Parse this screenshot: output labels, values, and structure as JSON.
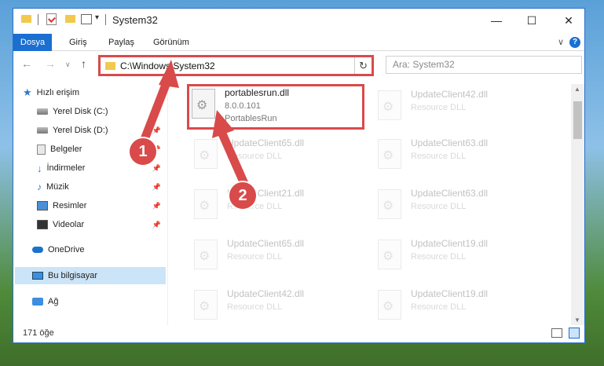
{
  "titlebar": {
    "title": "System32",
    "dropdown_glyph": "▾",
    "minimize": "—",
    "maximize": "☐",
    "close": "✕"
  },
  "ribbon": {
    "tabs": [
      "Dosya",
      "Giriş",
      "Paylaş",
      "Görünüm"
    ],
    "chevron": "∨",
    "help": "?"
  },
  "navigation": {
    "back": "←",
    "forward": "→",
    "recent": "∨",
    "up": "↑",
    "address": "C:\\Windows\\System32",
    "refresh": "↻",
    "search_placeholder": "Ara: System32"
  },
  "sidebar": {
    "items": [
      {
        "label": "Hızlı erişim",
        "icon": "star-icon",
        "pinned": false
      },
      {
        "label": "Yerel Disk (C:)",
        "icon": "disk-icon",
        "pinned": true
      },
      {
        "label": "Yerel Disk (D:)",
        "icon": "disk-icon",
        "pinned": true
      },
      {
        "label": "Belgeler",
        "icon": "document-icon",
        "pinned": true
      },
      {
        "label": "İndirmeler",
        "icon": "download-icon",
        "pinned": true
      },
      {
        "label": "Müzik",
        "icon": "music-icon",
        "pinned": true
      },
      {
        "label": "Resimler",
        "icon": "pictures-icon",
        "pinned": true
      },
      {
        "label": "Videolar",
        "icon": "video-icon",
        "pinned": true
      },
      {
        "label": "OneDrive",
        "icon": "cloud-icon",
        "pinned": false
      },
      {
        "label": "Bu bilgisayar",
        "icon": "computer-icon",
        "pinned": false,
        "selected": true
      },
      {
        "label": "Ağ",
        "icon": "network-icon",
        "pinned": false
      }
    ],
    "pin_glyph": "📌"
  },
  "files": [
    {
      "name": "portablesrun.dll",
      "version": "8.0.0.101",
      "description": "PortablesRun",
      "highlighted": true
    },
    {
      "name": "UpdateClient42.dll",
      "description": "Resource DLL"
    },
    {
      "name": "UpdateClient65.dll",
      "description": "Resource DLL"
    },
    {
      "name": "UpdateClient63.dll",
      "description": "Resource DLL"
    },
    {
      "name": "UpdateClient21.dll",
      "description": "Resource DLL"
    },
    {
      "name": "UpdateClient63.dll",
      "description": "Resource DLL"
    },
    {
      "name": "UpdateClient65.dll",
      "description": "Resource DLL"
    },
    {
      "name": "UpdateClient19.dll",
      "description": "Resource DLL"
    },
    {
      "name": "UpdateClient42.dll",
      "description": "Resource DLL"
    },
    {
      "name": "UpdateClient19.dll",
      "description": "Resource DLL"
    }
  ],
  "statusbar": {
    "count": "171 öğe"
  },
  "annotations": {
    "marker_1": "1",
    "marker_2": "2",
    "color": "#d94a4a"
  },
  "colors": {
    "accent": "#1a6fd1",
    "selection": "#cce4f7",
    "annotation_red": "#d94a4a"
  }
}
